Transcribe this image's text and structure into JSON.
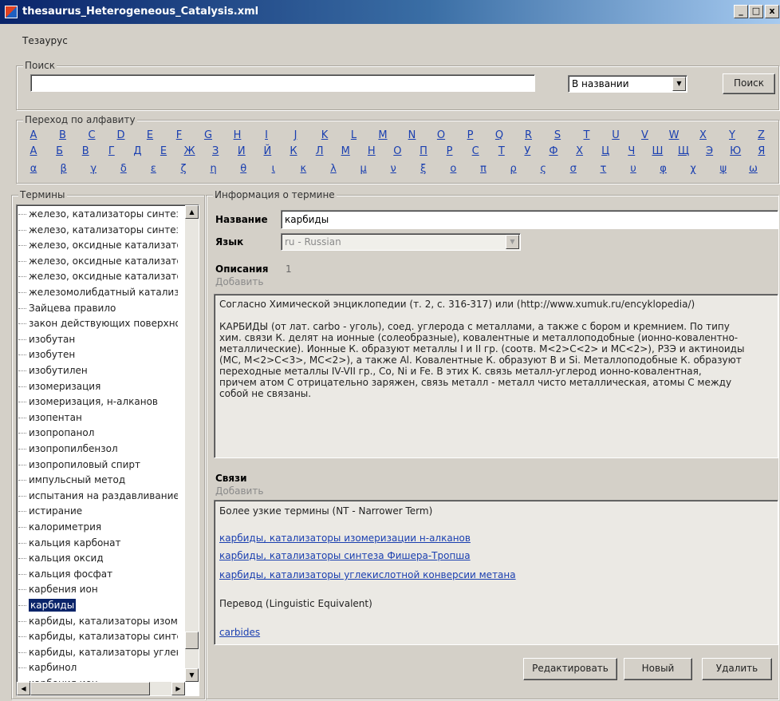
{
  "window": {
    "title": "thesaurus_Heterogeneous_Catalysis.xml",
    "minimize": "_",
    "maximize": "□",
    "close": "x"
  },
  "menu": {
    "items": [
      "Тезаурус"
    ]
  },
  "search": {
    "legend": "Поиск",
    "value": "",
    "mode_selected": "В названии",
    "button_label": "Поиск"
  },
  "alphabet": {
    "legend": "Переход по алфавиту",
    "latin": [
      "A",
      "B",
      "C",
      "D",
      "E",
      "F",
      "G",
      "H",
      "I",
      "J",
      "K",
      "L",
      "M",
      "N",
      "O",
      "P",
      "Q",
      "R",
      "S",
      "T",
      "U",
      "V",
      "W",
      "X",
      "Y",
      "Z"
    ],
    "cyrillic": [
      "А",
      "Б",
      "В",
      "Г",
      "Д",
      "Е",
      "Ж",
      "З",
      "И",
      "Й",
      "К",
      "Л",
      "М",
      "Н",
      "О",
      "П",
      "Р",
      "С",
      "Т",
      "У",
      "Ф",
      "Х",
      "Ц",
      "Ч",
      "Ш",
      "Щ",
      "Э",
      "Ю",
      "Я"
    ],
    "greek": [
      "α",
      "β",
      "γ",
      "δ",
      "ε",
      "ζ",
      "η",
      "θ",
      "ι",
      "κ",
      "λ",
      "μ",
      "ν",
      "ξ",
      "ο",
      "π",
      "ρ",
      "ς",
      "σ",
      "τ",
      "υ",
      "φ",
      "χ",
      "ψ",
      "ω"
    ]
  },
  "terms": {
    "legend": "Термины",
    "selected_index": 25,
    "items": [
      "железо, катализаторы синтез",
      "железо, катализаторы синтез",
      "железо, оксидные катализато",
      "железо, оксидные катализато",
      "железо, оксидные катализато",
      "железомолибдатный катализ",
      "Зайцева правило",
      "закон действующих поверхно",
      "изобутан",
      "изобутен",
      "изобутилен",
      "изомеризация",
      "изомеризация, н-алканов",
      "изопентан",
      "изопропанол",
      "изопропилбензол",
      "изопропиловый спирт",
      "импульсный метод",
      "испытания на раздавливание",
      "истирание",
      "калориметрия",
      "кальция карбонат",
      "кальция оксид",
      "кальция фосфат",
      "карбения ион",
      "карбиды",
      "карбиды, катализаторы изоме",
      "карбиды, катализаторы синте",
      "карбиды, катализаторы углек",
      "карбинол",
      "карбония ион"
    ]
  },
  "info": {
    "legend": "Информация о термине",
    "name_label": "Название",
    "name_value": "карбиды",
    "lang_label": "Язык",
    "lang_value": "ru - Russian",
    "desc_label": "Описания",
    "desc_count": "1",
    "add_label": "Добавить",
    "description_lines": [
      "Согласно Химической энциклопедии (т. 2, с. 316-317) или (http://www.xumuk.ru/encyklopedia/)",
      "",
      "КАРБИДЫ (от лат. carbo - уголь), соед. углерода с металлами, а также с бором и кремнием. По типу",
      "хим. связи К. делят на ионные (солеобразные), ковалентные и металлоподобные (ионно-ковалентно-",
      "металлические). Ионные К. образуют металлы I и II гр. (соотв. M<2>C<2> и MC<2>), РЗЭ и актиноиды",
      "(MC, M<2>C<3>, MC<2>), а также Al. Ковалентные К. образуют B и Si. Металлоподобные К. образуют",
      "переходные металлы IV-VII гр., Co, Ni и Fe. В этих К. связь металл-углерод ионно-ковалентная,",
      "причем атом C отрицательно заряжен, связь металл - металл чисто металлическая, атомы C между",
      "собой не связаны."
    ],
    "links_label": "Связи",
    "links_add_label": "Добавить",
    "narrower_header": "Более узкие термины (NT - Narrower Term)",
    "narrower_links": [
      "карбиды, катализаторы изомеризации н-алканов",
      "карбиды, катализаторы синтеза Фишера-Тропша",
      "карбиды, катализаторы углекислотной конверсии метана"
    ],
    "equivalent_header": "Перевод (Linguistic Equivalent)",
    "equivalent_links": [
      "carbides"
    ]
  },
  "buttons": {
    "edit": "Редактировать",
    "new": "Новый",
    "delete": "Удалить"
  }
}
